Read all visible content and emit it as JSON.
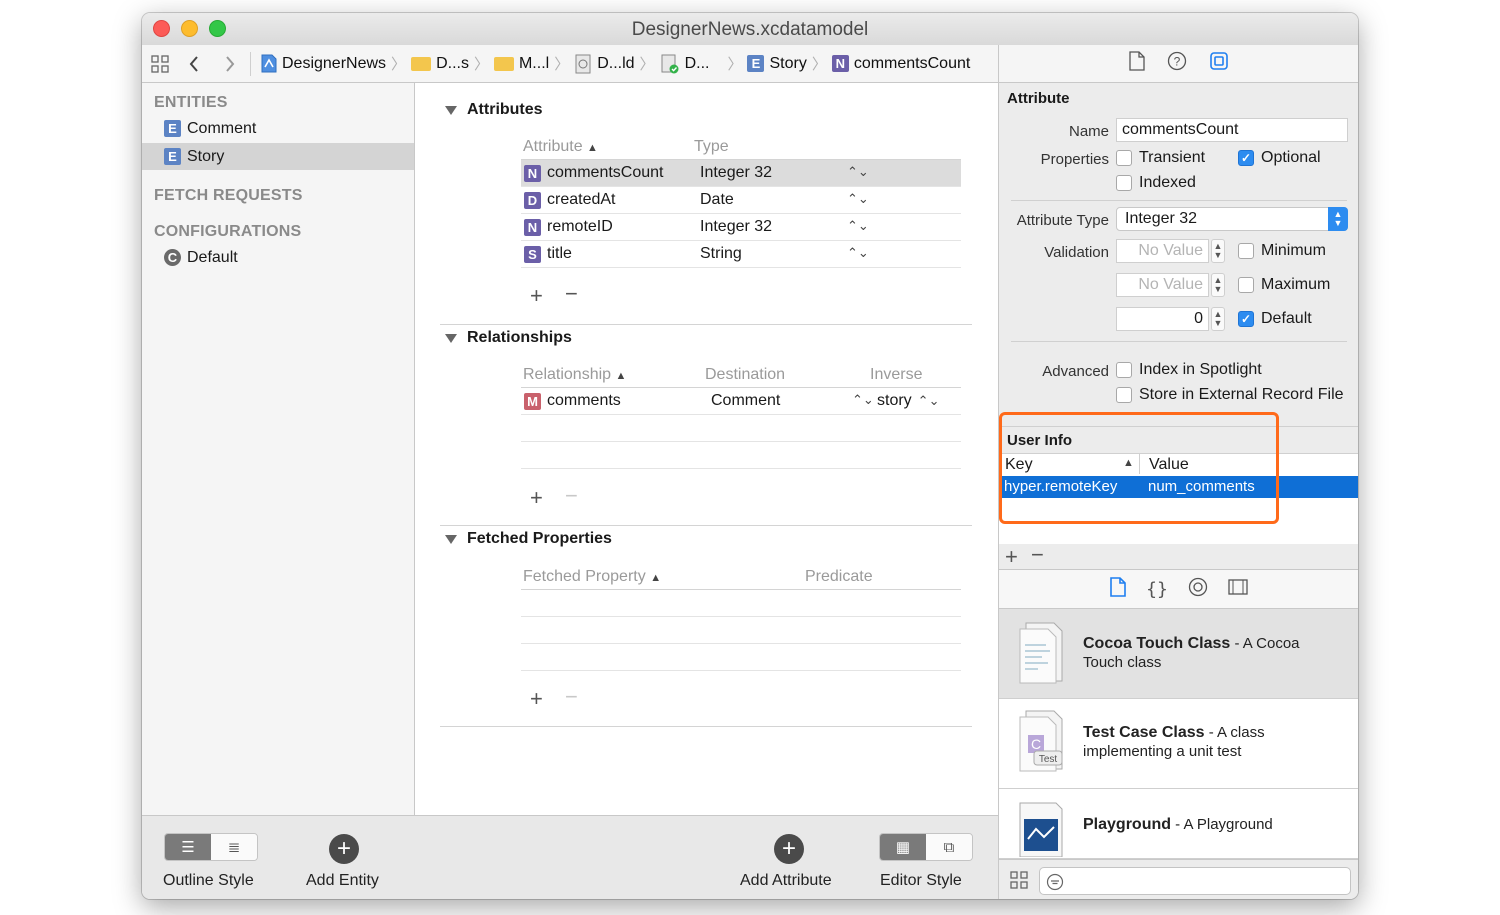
{
  "window": {
    "title": "DesignerNews.xcdatamodel"
  },
  "breadcrumbs": [
    {
      "label": "DesignerNews",
      "icon": "project-icon"
    },
    {
      "label": "D...s",
      "icon": "folder-icon"
    },
    {
      "label": "M...l",
      "icon": "folder-icon"
    },
    {
      "label": "D...ld",
      "icon": "xcdatamodeld-icon"
    },
    {
      "label": "D...",
      "icon": "xcdatamodel-icon"
    },
    {
      "label": "Story",
      "badge": "E"
    },
    {
      "label": "commentsCount",
      "badge": "N"
    }
  ],
  "sidebar": {
    "entities_header": "ENTITIES",
    "entities": [
      {
        "badge": "E",
        "label": "Comment"
      },
      {
        "badge": "E",
        "label": "Story"
      }
    ],
    "fetch_header": "FETCH REQUESTS",
    "config_header": "CONFIGURATIONS",
    "configurations": [
      {
        "badge": "C",
        "label": "Default"
      }
    ]
  },
  "attributes": {
    "title": "Attributes",
    "col_attribute": "Attribute",
    "col_type": "Type",
    "rows": [
      {
        "badge": "N",
        "name": "commentsCount",
        "type": "Integer 32"
      },
      {
        "badge": "D",
        "name": "createdAt",
        "type": "Date"
      },
      {
        "badge": "N",
        "name": "remoteID",
        "type": "Integer 32"
      },
      {
        "badge": "S",
        "name": "title",
        "type": "String"
      }
    ]
  },
  "relationships": {
    "title": "Relationships",
    "col_relationship": "Relationship",
    "col_destination": "Destination",
    "col_inverse": "Inverse",
    "rows": [
      {
        "badge": "M",
        "name": "comments",
        "destination": "Comment",
        "inverse": "story"
      }
    ]
  },
  "fetched": {
    "title": "Fetched Properties",
    "col_property": "Fetched Property",
    "col_predicate": "Predicate"
  },
  "bottombar": {
    "outline_style": "Outline Style",
    "add_entity": "Add Entity",
    "add_attribute": "Add Attribute",
    "editor_style": "Editor Style"
  },
  "inspector": {
    "section": "Attribute",
    "name_label": "Name",
    "name_value": "commentsCount",
    "properties_label": "Properties",
    "transient": "Transient",
    "optional": "Optional",
    "indexed": "Indexed",
    "attribute_type_label": "Attribute Type",
    "attribute_type_value": "Integer 32",
    "validation_label": "Validation",
    "no_value": "No Value",
    "minimum": "Minimum",
    "maximum": "Maximum",
    "default_value": "0",
    "default": "Default",
    "advanced_label": "Advanced",
    "spotlight": "Index in Spotlight",
    "external": "Store in External Record File",
    "user_info": "User Info",
    "key_col": "Key",
    "value_col": "Value",
    "user_info_rows": [
      {
        "key": "hyper.remoteKey",
        "value": "num_comments"
      }
    ]
  },
  "library": [
    {
      "title": "Cocoa Touch Class",
      "desc": " - A Cocoa Touch class"
    },
    {
      "title": "Test Case Class",
      "desc": " - A class implementing a unit test"
    },
    {
      "title": "Playground",
      "desc": " - A Playground"
    }
  ],
  "colors": {
    "accent": "#2d8cf0",
    "selection": "#0f6fd6",
    "highlight": "#ff6a1a"
  }
}
